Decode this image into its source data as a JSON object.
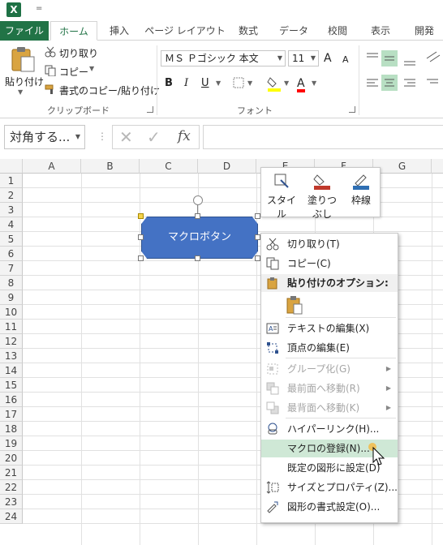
{
  "quick_access": {
    "app_icon": "X",
    "customize_caret": "="
  },
  "tabs": [
    "ファイル",
    "ホーム",
    "挿入",
    "ページ レイアウト",
    "数式",
    "データ",
    "校閲",
    "表示",
    "開発"
  ],
  "ribbon": {
    "clipboard": {
      "paste": "貼り付け",
      "cut": "切り取り",
      "copy": "コピー",
      "format_painter": "書式のコピー/貼り付け",
      "group_label": "クリップボード"
    },
    "font": {
      "font_name": "ＭＳ Ｐゴシック 本文",
      "font_size": "11",
      "grow": "A",
      "shrink": "A",
      "bold": "B",
      "italic": "I",
      "underline": "U",
      "font_color_letter": "A",
      "group_label": "フォント"
    }
  },
  "name_box": "対角する...",
  "fx_label": "fx",
  "columns": [
    "A",
    "B",
    "C",
    "D",
    "E",
    "F",
    "G"
  ],
  "rows": [
    "1",
    "2",
    "3",
    "4",
    "5",
    "6",
    "7",
    "8",
    "9",
    "10",
    "11",
    "12",
    "13",
    "14",
    "15",
    "16",
    "17",
    "18",
    "19",
    "20",
    "21",
    "22",
    "23",
    "24"
  ],
  "shape": {
    "label": "マクロボタン",
    "fill": "#4472c4"
  },
  "mini_toolbar": {
    "style": "スタイル",
    "fill": "塗りつぶし",
    "outline": "枠線"
  },
  "context_menu": {
    "cut": "切り取り(T)",
    "copy": "コピー(C)",
    "paste_options": "貼り付けのオプション:",
    "edit_text": "テキストの編集(X)",
    "edit_points": "頂点の編集(E)",
    "group": "グループ化(G)",
    "bring_forward": "最前面へ移動(R)",
    "send_backward": "最背面へ移動(K)",
    "hyperlink": "ハイパーリンク(H)...",
    "assign_macro": "マクロの登録(N)...",
    "set_default": "既定の図形に設定(D)",
    "size_properties": "サイズとプロパティ(Z)...",
    "format_shape": "図形の書式設定(O)..."
  },
  "colors": {
    "excel_green": "#217346",
    "highlight": "#cfe8d6",
    "shape_fill": "#4472c4"
  }
}
